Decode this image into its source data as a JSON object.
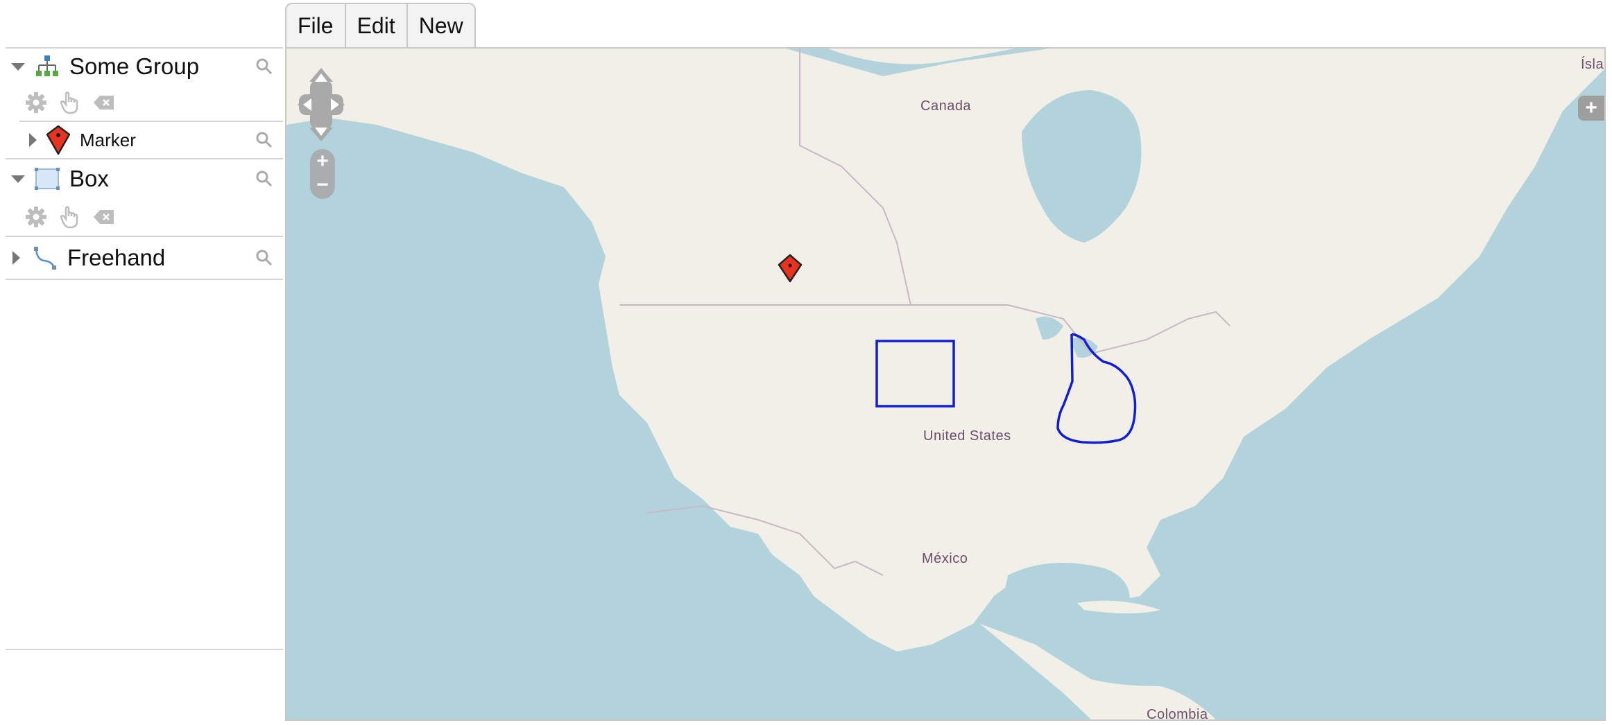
{
  "menu": {
    "tabs": [
      "File",
      "Edit",
      "New"
    ]
  },
  "layers": {
    "group": {
      "label": "Some Group",
      "child": {
        "label": "Marker"
      }
    },
    "box": {
      "label": "Box"
    },
    "freehand": {
      "label": "Freehand"
    }
  },
  "map": {
    "labels": {
      "canada": "Canada",
      "united_states": "United States",
      "mexico": "México",
      "colombia": "Colombia",
      "edge": "Ísla"
    },
    "zoom_in": "+",
    "zoom_out": "−",
    "layer_switcher": "+"
  },
  "colors": {
    "water": "#b3d3dc",
    "land": "#f2efe9",
    "drawing": "#1020d0",
    "marker": "#e8331f"
  }
}
